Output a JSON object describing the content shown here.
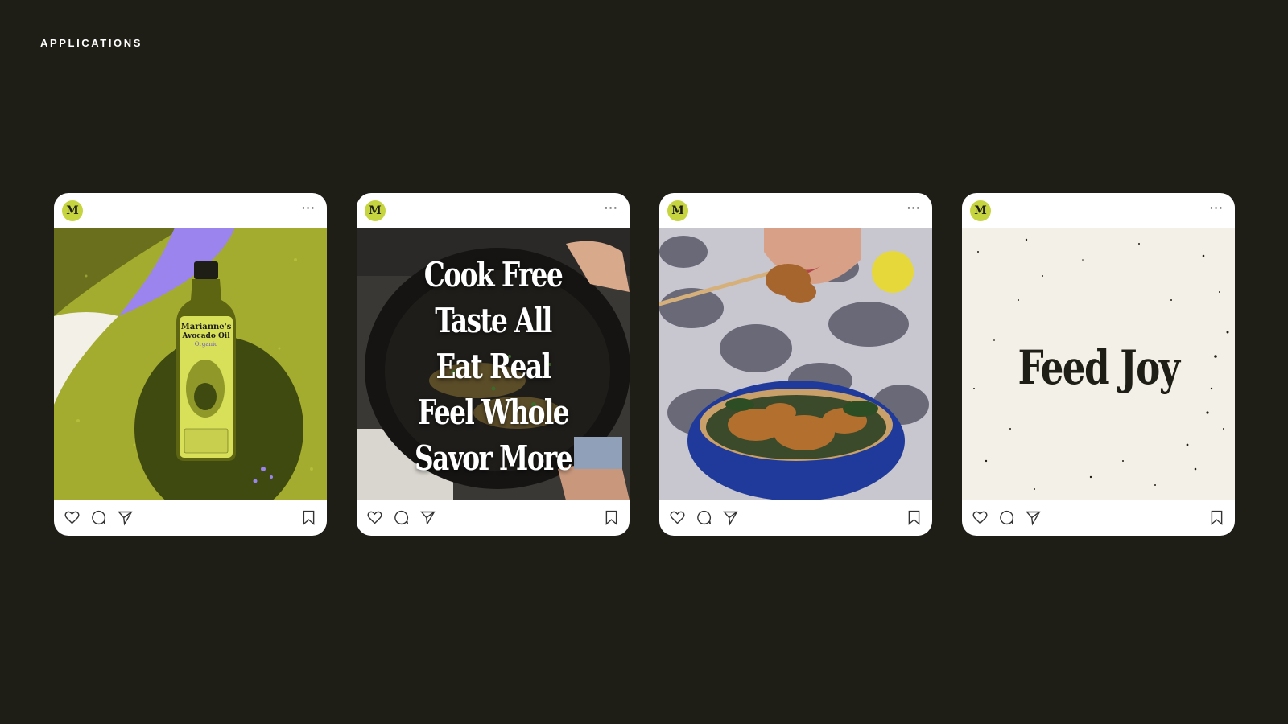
{
  "section": {
    "label": "APPLICATIONS"
  },
  "posts": [
    {
      "avatar_letter": "M",
      "more": "···",
      "bottle": {
        "brand": "Marianne's",
        "product": "Avocado Oil",
        "variant": "Organic"
      }
    },
    {
      "avatar_letter": "M",
      "more": "···",
      "lines": [
        "Cook Free",
        "Taste All",
        "Eat Real",
        "Feel Whole",
        "Savor More"
      ]
    },
    {
      "avatar_letter": "M",
      "more": "···"
    },
    {
      "avatar_letter": "M",
      "more": "···",
      "headline": "Feed Joy"
    }
  ],
  "colors": {
    "background": "#1e1d16",
    "avatar": "#c5d43f",
    "olive": "#a3ac2f",
    "dark_olive": "#3f4a10",
    "lavender": "#9b84ee",
    "cream": "#f3f0e8",
    "bowl_blue": "#1f3a9a"
  },
  "icons": [
    "heart-icon",
    "comment-icon",
    "share-icon",
    "bookmark-icon"
  ]
}
